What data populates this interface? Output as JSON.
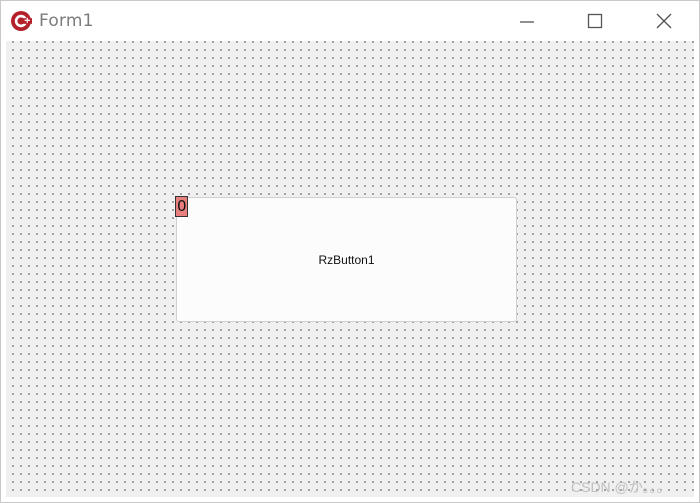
{
  "window": {
    "title": "Form1",
    "icon": "cpp-builder-icon",
    "caption_buttons": {
      "minimize": "minimize-icon",
      "maximize": "maximize-icon",
      "close": "close-icon"
    }
  },
  "designer": {
    "grid": true,
    "background_color": "#f0f0f0"
  },
  "components": [
    {
      "type": "TRzButton",
      "caption": "RzButton1",
      "tab_order": "0"
    }
  ],
  "watermark": "CSDN @か。。。",
  "colors": {
    "tab_order_badge": "#e77f7f",
    "icon_red": "#b3202a",
    "caption_glyph": "#555555"
  }
}
